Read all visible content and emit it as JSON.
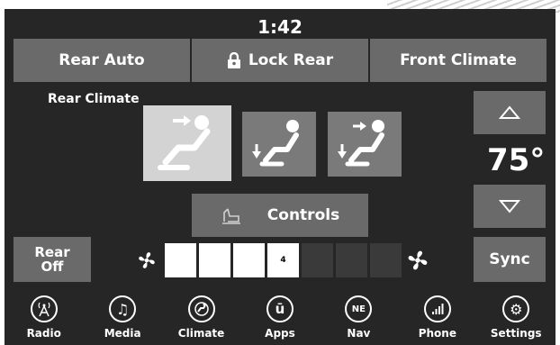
{
  "header": {
    "time": "1:42"
  },
  "top_buttons": {
    "rear_auto": "Rear Auto",
    "lock_rear": "Lock Rear",
    "front_climate": "Front Climate"
  },
  "rear_climate": {
    "label": "Rear Climate",
    "temperature": "75°"
  },
  "controls_button": "Controls",
  "rear_off_button": {
    "line1": "Rear",
    "line2": "Off"
  },
  "sync_button": "Sync",
  "fan": {
    "level": 4,
    "max": 7,
    "level_label": "4"
  },
  "nav": {
    "items": [
      {
        "label": "Radio",
        "icon": "radio-icon",
        "glyph": "📡"
      },
      {
        "label": "Media",
        "icon": "music-note-icon",
        "glyph": "♫"
      },
      {
        "label": "Climate",
        "icon": "climate-icon",
        "glyph": "⚙"
      },
      {
        "label": "Apps",
        "icon": "apps-icon",
        "glyph": "ū"
      },
      {
        "label": "Nav",
        "icon": "compass-icon",
        "glyph": "NE"
      },
      {
        "label": "Phone",
        "icon": "phone-signal-icon",
        "glyph": "ıll"
      },
      {
        "label": "Settings",
        "icon": "gear-icon",
        "glyph": "⚙"
      }
    ]
  }
}
